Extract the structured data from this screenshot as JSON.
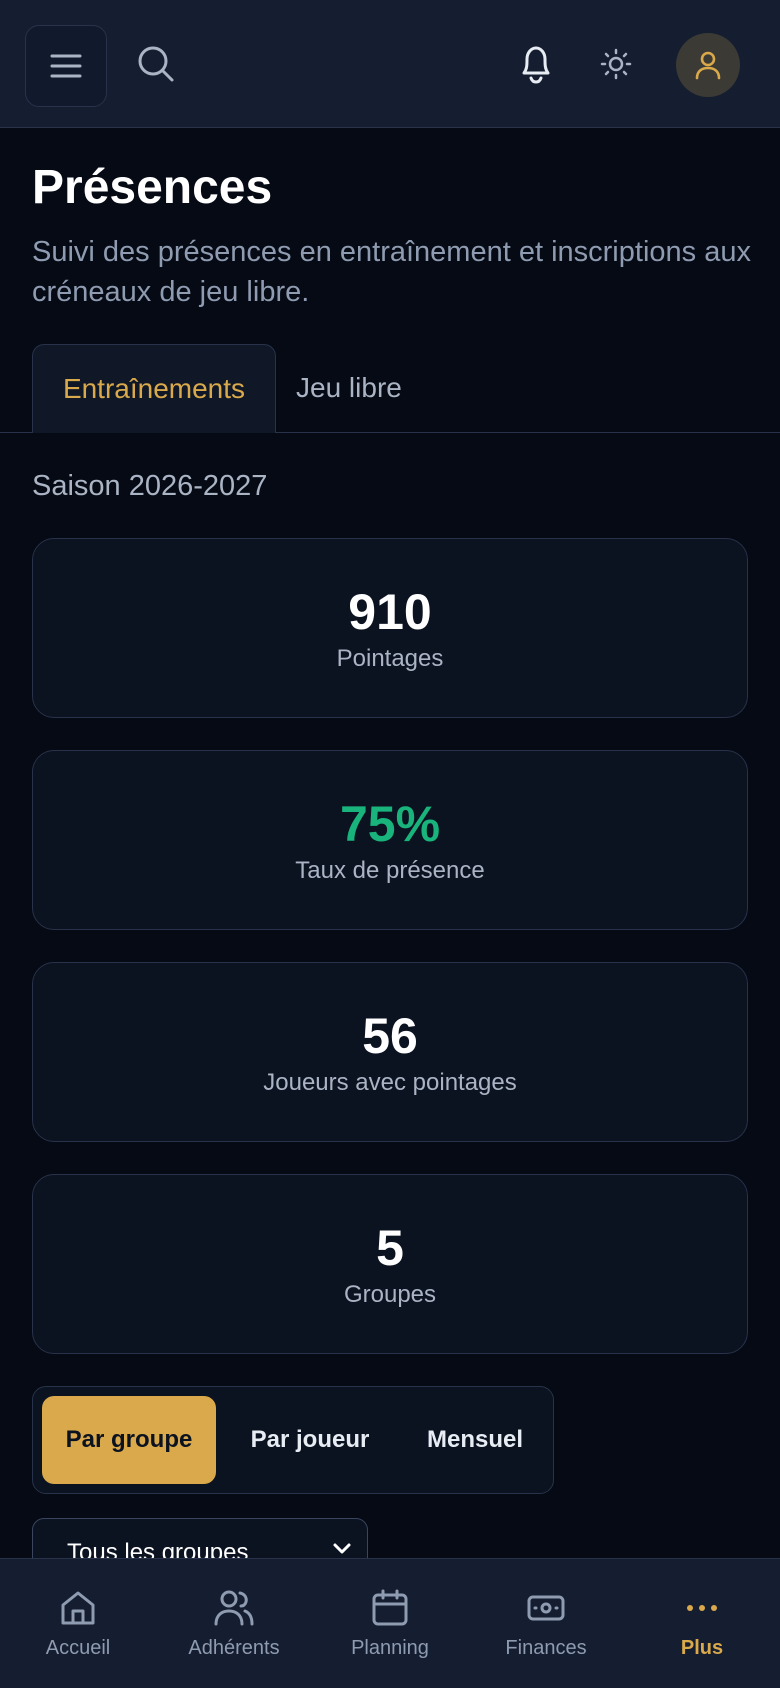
{
  "header": {
    "title": "Présences",
    "subtitle": "Suivi des présences en entraînement et inscriptions aux créneaux de jeu libre."
  },
  "tabs": [
    {
      "label": "Entraînements",
      "active": true
    },
    {
      "label": "Jeu libre",
      "active": false
    }
  ],
  "season": "Saison 2026-2027",
  "stats": [
    {
      "value": "910",
      "label": "Pointages"
    },
    {
      "value": "75%",
      "label": "Taux de présence",
      "color": "#19b37c"
    },
    {
      "value": "56",
      "label": "Joueurs avec pointages"
    },
    {
      "value": "5",
      "label": "Groupes"
    }
  ],
  "view_modes": [
    {
      "label": "Par groupe",
      "active": true
    },
    {
      "label": "Par joueur",
      "active": false
    },
    {
      "label": "Mensuel",
      "active": false
    }
  ],
  "group_filter": {
    "selected": "Tous les groupes"
  },
  "bottom_nav": [
    {
      "label": "Accueil",
      "icon": "home-icon"
    },
    {
      "label": "Adhérents",
      "icon": "users-icon"
    },
    {
      "label": "Planning",
      "icon": "calendar-icon"
    },
    {
      "label": "Finances",
      "icon": "banknote-icon"
    },
    {
      "label": "Plus",
      "icon": "more-icon",
      "active": true
    }
  ],
  "colors": {
    "accent": "#d9a94b",
    "success": "#19b37c",
    "background": "#050a14",
    "surface": "#151d30"
  }
}
